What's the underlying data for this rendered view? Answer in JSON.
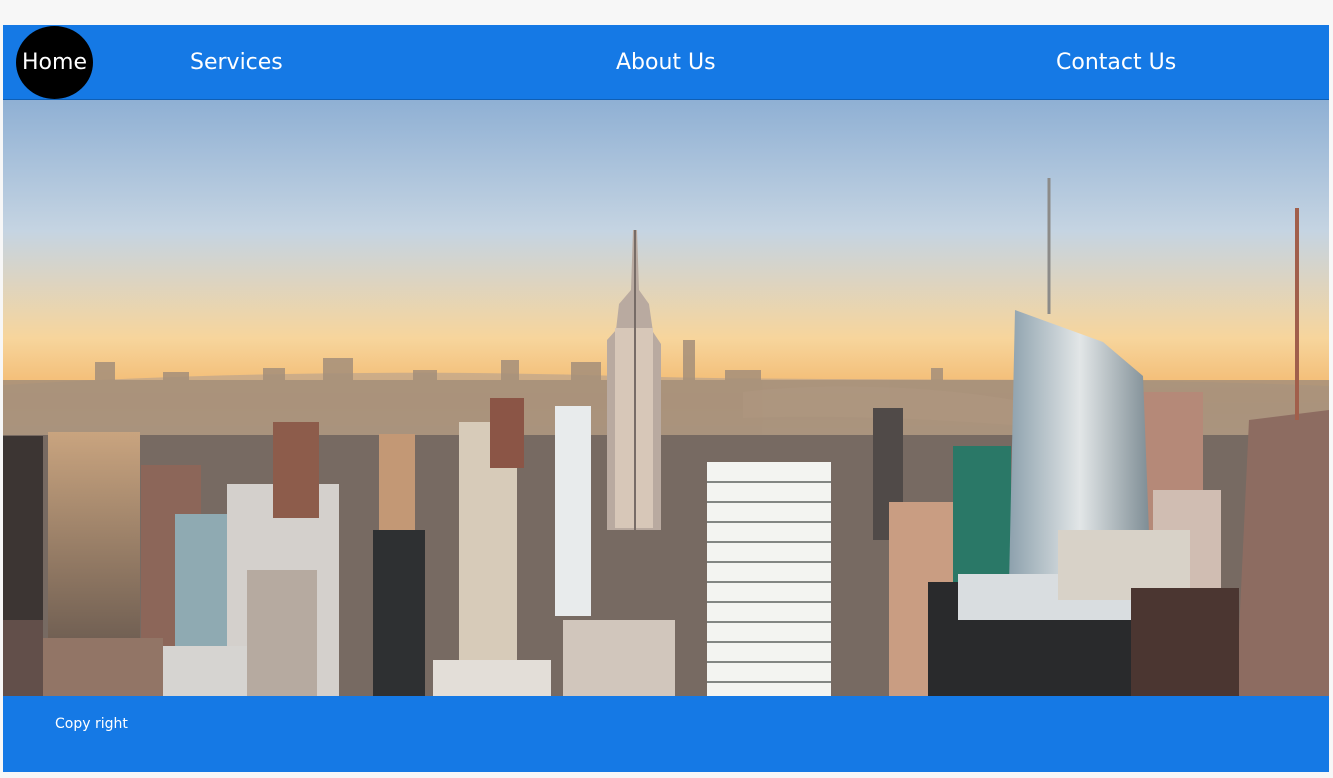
{
  "navigation": {
    "home_label": "Home",
    "services_label": "Services",
    "about_label": "About Us",
    "contact_label": "Contact Us"
  },
  "hero": {
    "image_icon": "city-skyline-photo"
  },
  "footer": {
    "copyright_label": "Copy right"
  },
  "colors": {
    "primary_blue": "#1579e5",
    "home_circle": "#000000",
    "text": "#ffffff"
  }
}
